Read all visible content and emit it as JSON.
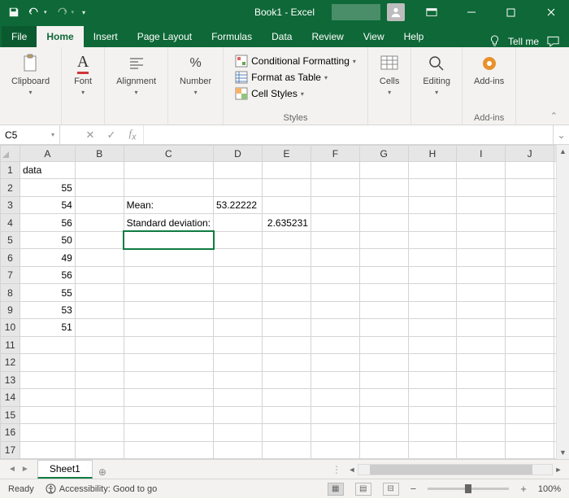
{
  "titlebar": {
    "title": "Book1 - Excel"
  },
  "tabs": {
    "file": "File",
    "home": "Home",
    "insert": "Insert",
    "pagelayout": "Page Layout",
    "formulas": "Formulas",
    "data": "Data",
    "review": "Review",
    "view": "View",
    "help": "Help",
    "tellme": "Tell me"
  },
  "ribbon": {
    "clipboard": {
      "label": "Clipboard"
    },
    "font": {
      "label": "Font"
    },
    "alignment": {
      "label": "Alignment"
    },
    "number": {
      "label": "Number"
    },
    "styles": {
      "label": "Styles",
      "cond": "Conditional Formatting",
      "table": "Format as Table",
      "cellstyles": "Cell Styles"
    },
    "cells": {
      "label": "Cells"
    },
    "editing": {
      "label": "Editing"
    },
    "addins": {
      "label": "Add-ins"
    },
    "addins2": {
      "label": "Add-ins"
    }
  },
  "namebox": "C5",
  "columns": [
    "A",
    "B",
    "C",
    "D",
    "E",
    "F",
    "G",
    "H",
    "I",
    "J"
  ],
  "rows": [
    {
      "r": "1",
      "A": "data"
    },
    {
      "r": "2",
      "A": "55"
    },
    {
      "r": "3",
      "A": "54",
      "C": "Mean:",
      "D": "53.22222"
    },
    {
      "r": "4",
      "A": "56",
      "C": "Standard deviation:",
      "E": "2.635231"
    },
    {
      "r": "5",
      "A": "50"
    },
    {
      "r": "6",
      "A": "49"
    },
    {
      "r": "7",
      "A": "56"
    },
    {
      "r": "8",
      "A": "55"
    },
    {
      "r": "9",
      "A": "53"
    },
    {
      "r": "10",
      "A": "51"
    },
    {
      "r": "11"
    },
    {
      "r": "12"
    },
    {
      "r": "13"
    },
    {
      "r": "14"
    },
    {
      "r": "15"
    },
    {
      "r": "16"
    },
    {
      "r": "17"
    }
  ],
  "sheet": {
    "name": "Sheet1"
  },
  "status": {
    "ready": "Ready",
    "access": "Accessibility: Good to go",
    "zoom": "100%"
  }
}
